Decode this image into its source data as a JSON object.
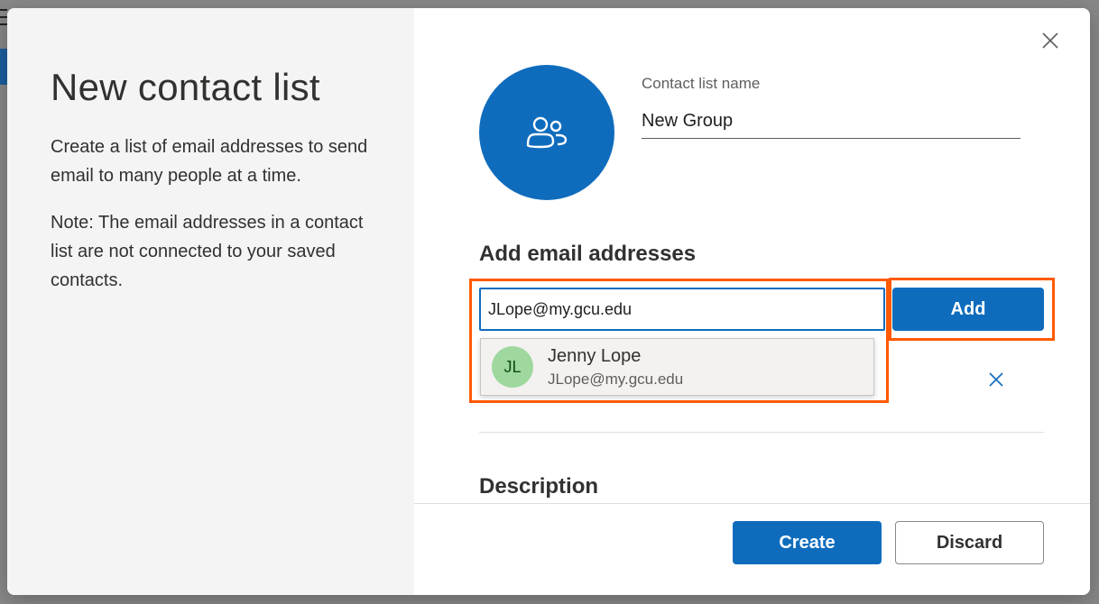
{
  "dialog": {
    "title": "New contact list",
    "description": "Create a list of email addresses to send email to many people at a time.",
    "note": "Note: The email addresses in a contact list are not connected to your saved contacts."
  },
  "contact_list": {
    "name_label": "Contact list name",
    "name_value": "New Group"
  },
  "add_section": {
    "heading": "Add email addresses",
    "input_value": "JLope@my.gcu.edu",
    "add_label": "Add"
  },
  "suggestion": {
    "initials": "JL",
    "name": "Jenny Lope",
    "email": "JLope@my.gcu.edu"
  },
  "description_section": {
    "heading": "Description"
  },
  "footer": {
    "create_label": "Create",
    "discard_label": "Discard"
  },
  "colors": {
    "primary": "#0f6cbd",
    "highlight": "#ff5a00",
    "suggestion_avatar": "#9fd89f"
  },
  "icons": {
    "close": "close-icon",
    "group": "people-group-icon",
    "remove": "remove-icon"
  }
}
